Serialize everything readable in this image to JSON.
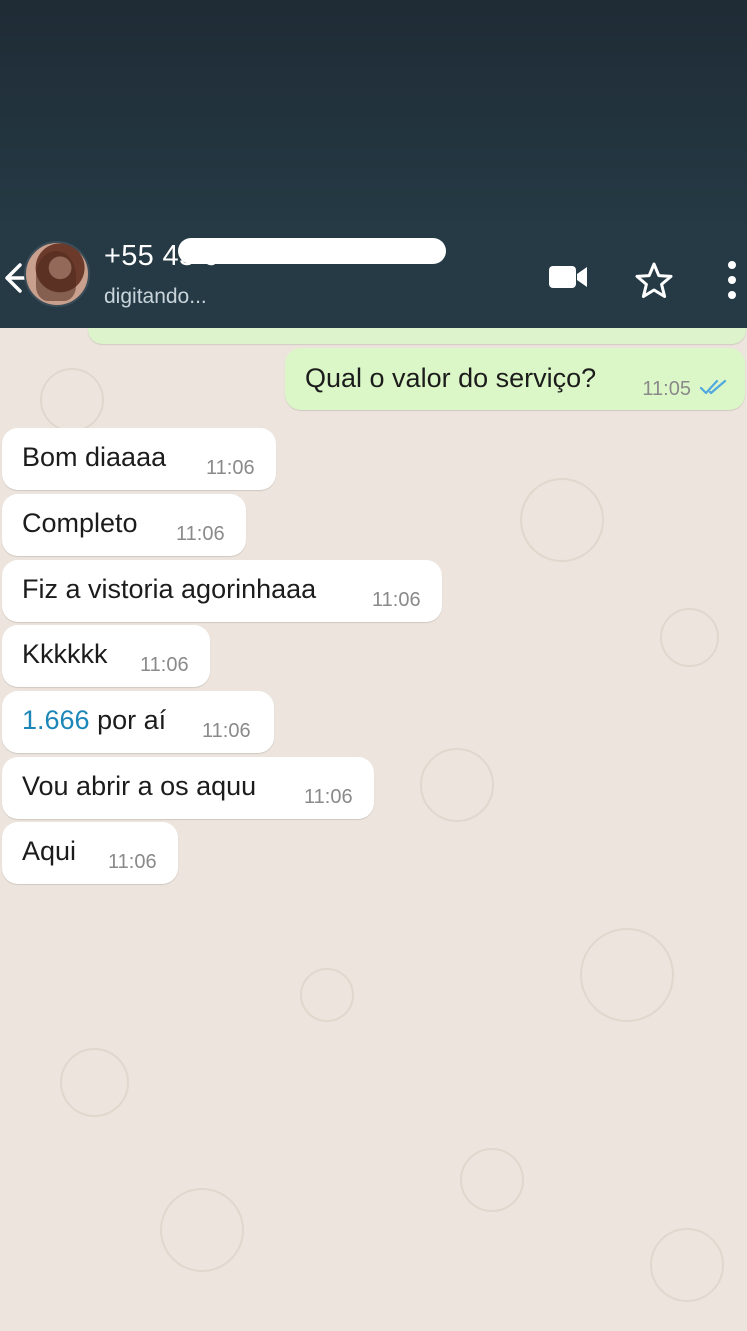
{
  "header": {
    "contact_name": "+55 45 9",
    "contact_status": "digitando...",
    "back_icon": "back-arrow-icon",
    "video_icon": "video-call-icon",
    "star_icon": "star-icon",
    "more_icon": "more-vertical-icon"
  },
  "colors": {
    "header_bg": "#253a45",
    "chat_bg": "#ede5dd",
    "outgoing_bubble": "#dcf7c7",
    "incoming_bubble": "#ffffff",
    "read_ticks": "#4fa8e0",
    "link_number": "#1c86b8"
  },
  "messages": {
    "outgoing": [
      {
        "text": "Qual o valor do serviço?",
        "time": "11:05",
        "status": "read"
      }
    ],
    "incoming": [
      {
        "text": "Bom diaaaa",
        "time": "11:06"
      },
      {
        "text": "Completo",
        "time": "11:06"
      },
      {
        "text": "Fiz a vistoria agorinhaaa",
        "time": "11:06"
      },
      {
        "text": "Kkkkkk",
        "time": "11:06"
      },
      {
        "number": "1.666",
        "text_rest": " por aí",
        "time": "11:06"
      },
      {
        "text": "Vou abrir a os aquu",
        "time": "11:06"
      },
      {
        "text": "Aqui",
        "time": "11:06"
      }
    ]
  }
}
